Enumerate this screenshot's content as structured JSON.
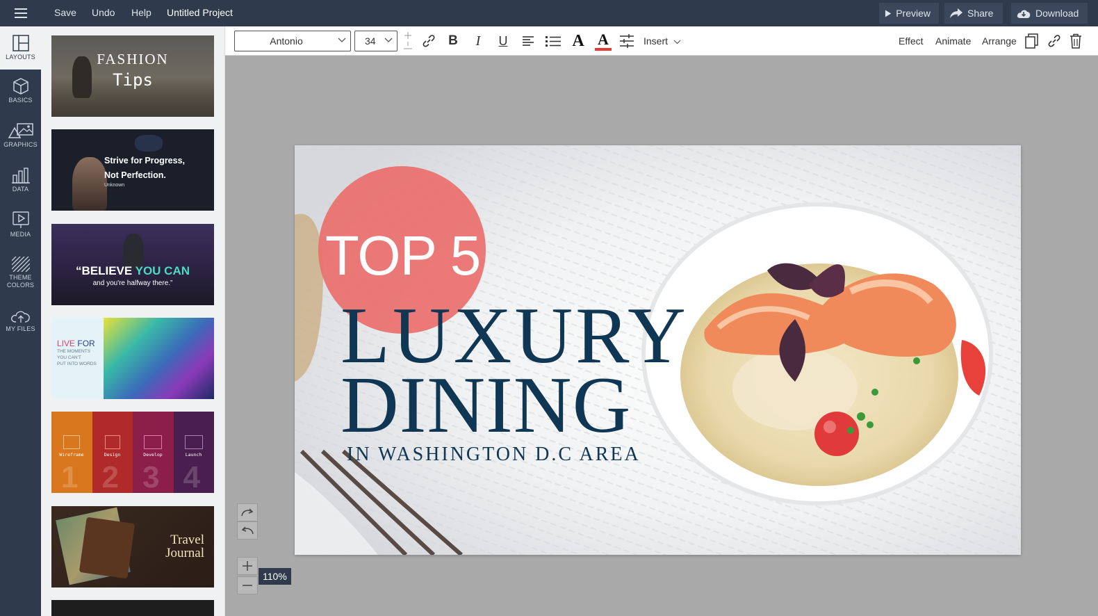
{
  "topbar": {
    "menu": [
      "Save",
      "Undo",
      "Help"
    ],
    "project_title": "Untitled Project",
    "preview_label": "Preview",
    "share_label": "Share",
    "download_label": "Download"
  },
  "rail": {
    "items": [
      {
        "label": "LAYOUTS",
        "icon": "layouts-icon"
      },
      {
        "label": "BASICS",
        "icon": "cube-icon"
      },
      {
        "label": "GRAPHICS",
        "icon": "shapes-icon"
      },
      {
        "label": "DATA",
        "icon": "chart-icon"
      },
      {
        "label": "MEDIA",
        "icon": "play-icon"
      },
      {
        "label": "THEME",
        "label2": "COLORS",
        "icon": "stripes-icon"
      },
      {
        "label": "MY FILES",
        "icon": "cloud-upload-icon"
      }
    ]
  },
  "layouts": {
    "t1": {
      "title": "FASHION",
      "subtitle": "Tips"
    },
    "t2": {
      "line1": "Strive for Progress,",
      "line2": "Not Perfection.",
      "author": "Unknown"
    },
    "t3": {
      "quote_a": "“BELIEVE ",
      "quote_b": "YOU CAN",
      "line2": "and you're halfway there.”"
    },
    "t4": {
      "live": "LIVE ",
      "for": "FOR",
      "line2": "THE MOMENTS",
      "line3": "YOU CAN'T",
      "line4": "PUT INTO WORDS"
    },
    "t5": {
      "steps": [
        "Wireframe",
        "Design",
        "Develop",
        "Launch"
      ],
      "numbers": [
        "1",
        "2",
        "3",
        "4"
      ]
    },
    "t6": {
      "line1": "Travel",
      "line2": "Journal"
    }
  },
  "format": {
    "font": "Antonio",
    "size": "34",
    "insert_label": "Insert",
    "effect_label": "Effect",
    "animate_label": "Animate",
    "arrange_label": "Arrange",
    "text_color": "#e53935"
  },
  "slide": {
    "badge": "TOP 5",
    "line1": "LUXURY",
    "line2": "DINING",
    "subtitle": "IN WASHINGTON D.C AREA"
  },
  "zoom": {
    "level": "110%"
  }
}
